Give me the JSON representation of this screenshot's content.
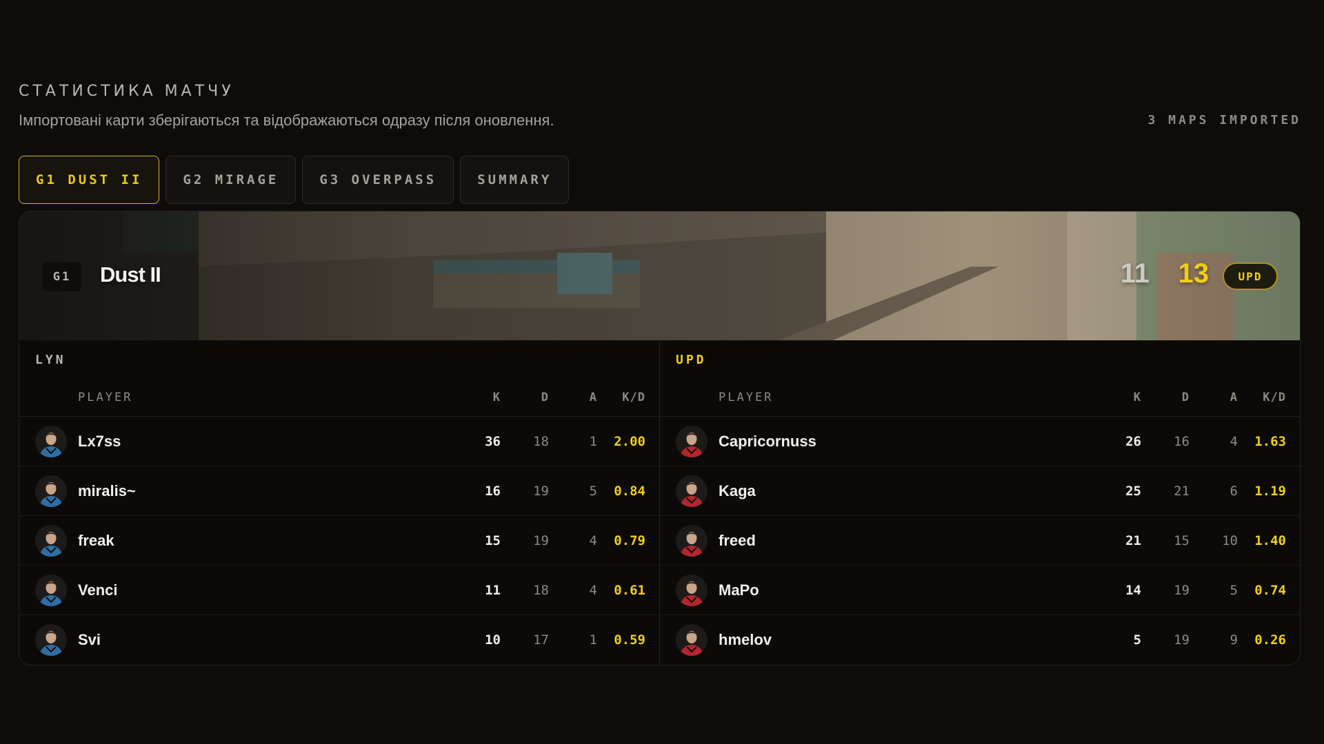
{
  "header": {
    "title": "СТАТИСТИКА МАТЧУ",
    "subtitle": "Імпортовані карти зберігаються та відображаються одразу після оновлення.",
    "maps_imported": "3 MAPS IMPORTED"
  },
  "tabs": [
    {
      "label": "G1 DUST II",
      "active": true
    },
    {
      "label": "G2 MIRAGE",
      "active": false
    },
    {
      "label": "G3 OVERPASS",
      "active": false
    },
    {
      "label": "SUMMARY",
      "active": false
    }
  ],
  "map": {
    "badge": "G1",
    "name": "Dust II",
    "score_left": "11",
    "score_right": "13",
    "winner": "UPD"
  },
  "columns": {
    "player": "PLAYER",
    "k": "K",
    "d": "D",
    "a": "A",
    "kd": "K/D"
  },
  "colors": {
    "accent": "#f2ce19",
    "team_left": "#2f6ea5",
    "team_right": "#b3262e"
  },
  "teams": [
    {
      "name": "LYN",
      "winner": false,
      "players": [
        {
          "name": "Lx7ss",
          "k": "36",
          "d": "18",
          "a": "1",
          "kd": "2.00"
        },
        {
          "name": "miralis~",
          "k": "16",
          "d": "19",
          "a": "5",
          "kd": "0.84"
        },
        {
          "name": "freak",
          "k": "15",
          "d": "19",
          "a": "4",
          "kd": "0.79"
        },
        {
          "name": "Venci",
          "k": "11",
          "d": "18",
          "a": "4",
          "kd": "0.61"
        },
        {
          "name": "Svi",
          "k": "10",
          "d": "17",
          "a": "1",
          "kd": "0.59"
        }
      ]
    },
    {
      "name": "UPD",
      "winner": true,
      "players": [
        {
          "name": "Capricornuss",
          "k": "26",
          "d": "16",
          "a": "4",
          "kd": "1.63"
        },
        {
          "name": "Kaga",
          "k": "25",
          "d": "21",
          "a": "6",
          "kd": "1.19"
        },
        {
          "name": "freed",
          "k": "21",
          "d": "15",
          "a": "10",
          "kd": "1.40"
        },
        {
          "name": "MaPo",
          "k": "14",
          "d": "19",
          "a": "5",
          "kd": "0.74"
        },
        {
          "name": "hmelov",
          "k": "5",
          "d": "19",
          "a": "9",
          "kd": "0.26"
        }
      ]
    }
  ]
}
